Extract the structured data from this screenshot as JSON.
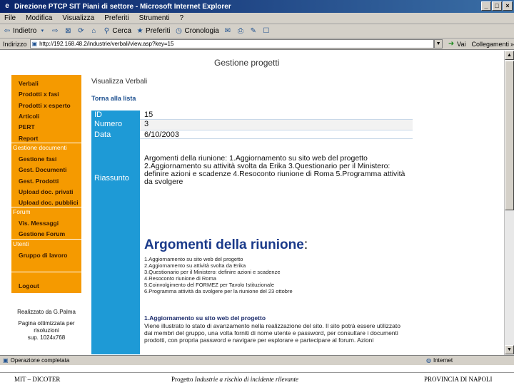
{
  "window": {
    "title": "Direzione PTCP SIT Piani di settore - Microsoft Internet Explorer",
    "controls": [
      "_",
      "□",
      "×"
    ]
  },
  "menu": [
    "File",
    "Modifica",
    "Visualizza",
    "Preferiti",
    "Strumenti",
    "?"
  ],
  "toolbar": {
    "back": "Indietro",
    "search": "Cerca",
    "favorites": "Preferiti",
    "history": "Cronologia"
  },
  "addressbar": {
    "label": "Indirizzo",
    "url": "http://192.168.48.2/industrie/verbali/view.asp?key=15",
    "go": "Vai",
    "links": "Collegamenti"
  },
  "page": {
    "title": "Gestione progetti",
    "user": "Visualizza Verbali",
    "back_link": "Torna alla lista"
  },
  "sidebar": {
    "items": [
      "Verbali",
      "Prodotti x fasi",
      "Prodotti x esperto",
      "Articoli",
      "PERT",
      "Report"
    ],
    "section_documents": "Gestione documenti",
    "documents_items": [
      "Gestione fasi",
      "Gest. Documenti",
      "Gest. Prodotti",
      "Upload doc. privati",
      "Upload doc. pubblici"
    ],
    "section_forum": "Forum",
    "forum_items": [
      "Vis. Messaggi",
      "Gestione Forum"
    ],
    "section_users": "Utenti",
    "users_items": [
      "Gruppo di lavoro"
    ],
    "logout": "Logout"
  },
  "credits": {
    "line1": "Realizzato da G.Palma",
    "line2": "Pagina ottimizzata per",
    "line3": "risoluzioni",
    "line4": "sup. 1024x768"
  },
  "record": {
    "id_label": "ID",
    "id_value": "15",
    "numero_label": "Numero",
    "numero_value": "3",
    "data_label": "Data",
    "data_value": "6/10/2003",
    "riassunto_label": "Riassunto",
    "riassunto_text": "Argomenti della riunione: 1.Aggiornamento su sito web del progetto 2.Aggiornamento su attività svolta da Erika 3.Questionario per il Ministero: definire azioni e scadenze 4.Resoconto riunione di Roma 5.Programma attività da svolgere"
  },
  "argomenti": {
    "title": "Argomenti della riunione",
    "colon": ":",
    "items": [
      "1.Aggiornamento su sito web del progetto",
      "2.Aggiornamento su attività svolta da Erika",
      "3.Questionario per il Ministero: definire azioni e scadenze",
      "4.Resoconto riunione di Roma",
      "5.Coinvolgimento del FORMEZ per Tavolo Istituzionale",
      "6.Programma attività da svolgere per la riunione del 23 ottobre"
    ],
    "item1_head": "1.Aggiornamento su sito web del progetto",
    "item1_desc": "Viene illustrato lo stato di avanzamento nella realizzazione del sito. Il sito potrà essere utilizzato dai membri del gruppo, una volta forniti di nome utente e password, per consultare i documenti prodotti, con propria password e navigare per esplorare e partecipare al forum. Azioni"
  },
  "status": {
    "left": "Operazione completata",
    "zone": "Internet"
  },
  "footer": {
    "left": "MIT – DICOTER",
    "mid_prefix": "Progetto",
    "mid_italic": "Industrie a rischio di incidente rilevante",
    "right": "PROVINCIA DI NAPOLI"
  }
}
